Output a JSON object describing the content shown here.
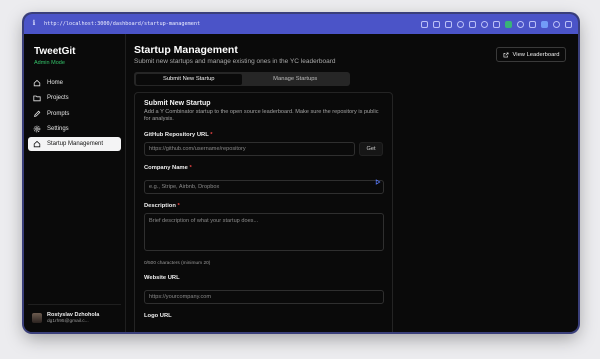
{
  "browser": {
    "url": "http://localhost:3000/dashboard/startup-management"
  },
  "sidebar": {
    "brand": "TweetGit",
    "mode": "Admin Mode",
    "items": [
      {
        "label": "Home",
        "icon": "home-icon",
        "active": false
      },
      {
        "label": "Projects",
        "icon": "folder-icon",
        "active": false
      },
      {
        "label": "Prompts",
        "icon": "pen-icon",
        "active": false
      },
      {
        "label": "Settings",
        "icon": "gear-icon",
        "active": false
      },
      {
        "label": "Startup Management",
        "icon": "home-icon",
        "active": true
      }
    ],
    "user": {
      "name": "Rostyslav Dzhohola",
      "email": "dg1rh95@gmail.c..."
    }
  },
  "header": {
    "title": "Startup Management",
    "subtitle": "Submit new startups and manage existing ones in the YC leaderboard",
    "view_button": "View Leaderboard"
  },
  "tabs": [
    {
      "label": "Submit New Startup",
      "active": true
    },
    {
      "label": "Manage Startups",
      "active": false
    }
  ],
  "form": {
    "title": "Submit New Startup",
    "description": "Add a Y Combinator startup to the open source leaderboard. Make sure the repository is public for analysis.",
    "github": {
      "label": "GitHub Repository URL",
      "placeholder": "https://github.com/username/repository",
      "button": "Get"
    },
    "company": {
      "label": "Company Name",
      "placeholder": "e.g., Stripe, Airbnb, Dropbox"
    },
    "desc": {
      "label": "Description",
      "placeholder": "Brief description of what your startup does...",
      "hint": "0/500 characters (minimum 20)"
    },
    "website": {
      "label": "Website URL",
      "placeholder": "https://yourcompany.com"
    },
    "logo": {
      "label": "Logo URL"
    },
    "required_marker": "*"
  },
  "colors": {
    "url_bar": "#4b54c8",
    "accent_green": "#34c46a",
    "required_red": "#ef4444",
    "background": "#0a0a0a"
  }
}
